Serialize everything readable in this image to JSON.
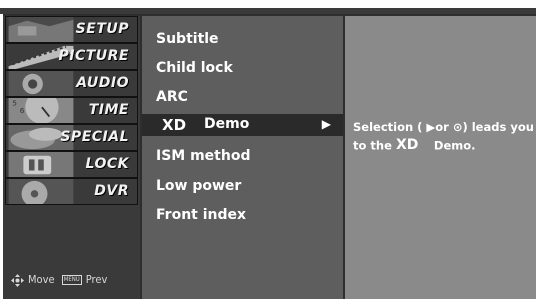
{
  "menu": {
    "items": [
      {
        "label": "SETUP",
        "active": true
      },
      {
        "label": "PICTURE"
      },
      {
        "label": "AUDIO"
      },
      {
        "label": "TIME"
      },
      {
        "label": "SPECIAL"
      },
      {
        "label": "LOCK"
      },
      {
        "label": "DVR"
      }
    ],
    "hint_move": "Move",
    "hint_menu_key": "MENU",
    "hint_prev": "Prev"
  },
  "options": {
    "items": [
      "Subtitle",
      "Child lock",
      "ARC",
      "Demo",
      "ISM method",
      "Low power",
      "Front index"
    ],
    "selected_index": 3,
    "xd_logo": "XD",
    "arrow": "▶"
  },
  "description": {
    "line1": "Selection ( ▶or ⊙) leads you",
    "line2_prefix": "to the",
    "xd_logo": "XD",
    "line2_suffix": "Demo",
    "dot": "."
  },
  "colors": {
    "left_panel": "#3a3a3a",
    "middle_panel": "#5e5e5e",
    "right_panel": "#8a8a8a",
    "highlight_row": "#2a2a2a"
  }
}
